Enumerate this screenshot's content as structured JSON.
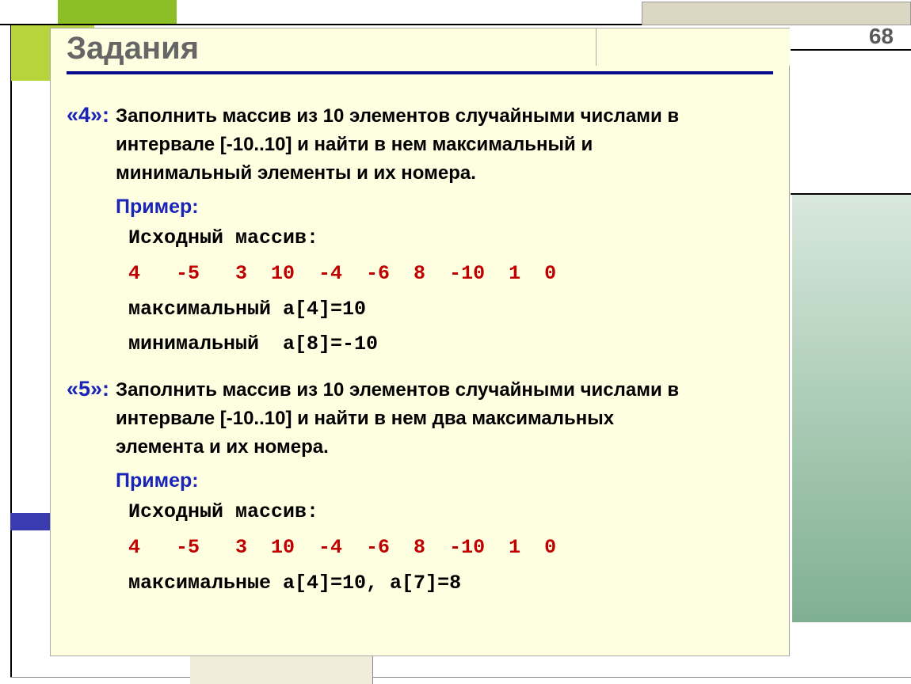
{
  "page_number": "68",
  "title": "Задания",
  "task4": {
    "grade": "«4»:",
    "text_line1": "Заполнить  массив из 10 элементов случайными числами в",
    "text_line2": "интервале [-10..10] и найти в нем максимальный и",
    "text_line3": "минимальный элементы и их номера.",
    "example_label": "Пример:",
    "src_label": "Исходный массив:",
    "array_line": "4   -5   3  10  -4  -6  8  -10  1  0",
    "max_line": "максимальный a[4]=10",
    "min_line": "минимальный  a[8]=-10"
  },
  "task5": {
    "grade": "«5»:",
    "text_line1": "Заполнить  массив из 10 элементов случайными числами в",
    "text_line2": "интервале [-10..10] и найти в нем два максимальных",
    "text_line3": "элемента и их номера.",
    "example_label": "Пример:",
    "src_label": "Исходный массив:",
    "array_line": "4   -5   3  10  -4  -6  8  -10  1  0",
    "max_line": "максимальные a[4]=10, a[7]=8"
  }
}
